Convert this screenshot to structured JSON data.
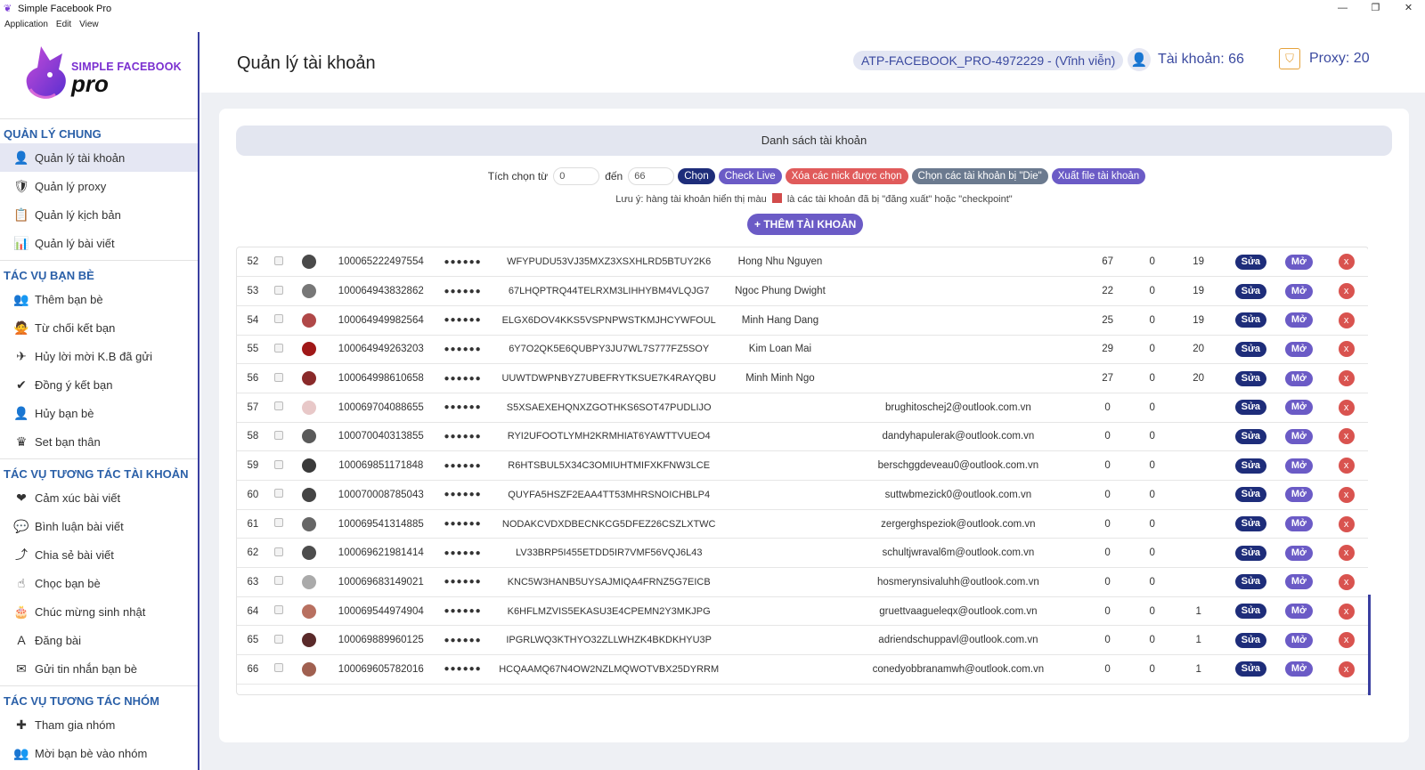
{
  "window": {
    "title": "Simple Facebook Pro",
    "controls": [
      "—",
      "❐",
      "✕"
    ]
  },
  "menu": [
    "Application",
    "Edit",
    "View"
  ],
  "logo": {
    "line1": "SIMPLE FACEBOOK",
    "line2": "pro"
  },
  "sidebar": {
    "sections": [
      {
        "title": "QUẢN LÝ CHUNG",
        "items": [
          {
            "label": "Quản lý tài khoản",
            "icon": "user-icon",
            "glyph": "👤",
            "active": true
          },
          {
            "label": "Quản lý proxy",
            "icon": "proxy-icon",
            "glyph": "🛡"
          },
          {
            "label": "Quản lý kịch bản",
            "icon": "script-icon",
            "glyph": "📋"
          },
          {
            "label": "Quản lý bài viết",
            "icon": "post-icon",
            "glyph": "📊"
          }
        ]
      },
      {
        "title": "TÁC VỤ BẠN BÈ",
        "items": [
          {
            "label": "Thêm bạn bè",
            "icon": "add-friend-icon",
            "glyph": "👥"
          },
          {
            "label": "Từ chối kết bạn",
            "icon": "decline-friend-icon",
            "glyph": "🙅"
          },
          {
            "label": "Hủy lời mời K.B đã gửi",
            "icon": "cancel-invite-icon",
            "glyph": "✈"
          },
          {
            "label": "Đồng ý kết bạn",
            "icon": "accept-friend-icon",
            "glyph": "✔"
          },
          {
            "label": "Hủy bạn bè",
            "icon": "unfriend-icon",
            "glyph": "👤"
          },
          {
            "label": "Set bạn thân",
            "icon": "best-friend-icon",
            "glyph": "♛"
          }
        ]
      },
      {
        "title": "TÁC VỤ TƯƠNG TÁC TÀI KHOẢN",
        "items": [
          {
            "label": "Cảm xúc bài viết",
            "icon": "reaction-icon",
            "glyph": "❤"
          },
          {
            "label": "Bình luận bài viết",
            "icon": "comment-icon",
            "glyph": "💬"
          },
          {
            "label": "Chia sẻ bài viết",
            "icon": "share-icon",
            "glyph": "⤴"
          },
          {
            "label": "Chọc bạn bè",
            "icon": "poke-icon",
            "glyph": "☝"
          },
          {
            "label": "Chúc mừng sinh nhật",
            "icon": "birthday-icon",
            "glyph": "🎂"
          },
          {
            "label": "Đăng bài",
            "icon": "post-a-icon",
            "glyph": "A"
          },
          {
            "label": "Gửi tin nhắn bạn bè",
            "icon": "messenger-icon",
            "glyph": "✉"
          }
        ]
      },
      {
        "title": "TÁC VỤ TƯƠNG TÁC NHÓM",
        "items": [
          {
            "label": "Tham gia nhóm",
            "icon": "join-group-icon",
            "glyph": "✚"
          },
          {
            "label": "Mời bạn bè vào nhóm",
            "icon": "invite-group-icon",
            "glyph": "👥"
          }
        ]
      }
    ]
  },
  "header": {
    "page_title": "Quản lý tài khoản",
    "license": "ATP-FACEBOOK_PRO-4972229 - (Vĩnh viễn)",
    "accounts": "Tài khoản: 66",
    "proxy": "Proxy: 20"
  },
  "list": {
    "title": "Danh sách tài khoản",
    "select_from_label": "Tích chọn từ",
    "from_value": "0",
    "to_label": "đến",
    "to_value": "66",
    "buttons": {
      "choose": "Chọn",
      "check_live": "Check Live",
      "delete_selected": "Xóa các nick được chọn",
      "select_die": "Chọn các tài khoản bị \"Die\"",
      "export": "Xuất file tài khoản"
    },
    "note_before": "Lưu ý: hàng tài khoản hiển thị màu",
    "note_after": "là các tài khoản đã bị \"đăng xuất\" hoặc \"checkpoint\"",
    "add_button": "+ THÊM TÀI KHOẢN",
    "row_buttons": {
      "edit": "Sửa",
      "open": "Mở",
      "delete": "x"
    },
    "password_mask": "●●●●●●"
  },
  "rows": [
    {
      "idx": "52",
      "uid": "100065222497554",
      "token": "WFYPUDU53VJ35MXZ3XSXHLRD5BTUY2K6",
      "name": "Hong Nhu Nguyen",
      "email": "",
      "n1": "67",
      "n2": "0",
      "n3": "19",
      "avatar": "#4a4a4a"
    },
    {
      "idx": "53",
      "uid": "100064943832862",
      "token": "67LHQPTRQ44TELRXM3LIHHYBM4VLQJG7",
      "name": "Ngoc Phung Dwight",
      "email": "",
      "n1": "22",
      "n2": "0",
      "n3": "19",
      "avatar": "#777"
    },
    {
      "idx": "54",
      "uid": "100064949982564",
      "token": "ELGX6DOV4KKS5VSPNPWSTKMJHCYWFOUL",
      "name": "Minh Hang Dang",
      "email": "",
      "n1": "25",
      "n2": "0",
      "n3": "19",
      "avatar": "#b04848"
    },
    {
      "idx": "55",
      "uid": "100064949263203",
      "token": "6Y7O2QK5E6QUBPY3JU7WL7S777FZ5SOY",
      "name": "Kim Loan Mai",
      "email": "",
      "n1": "29",
      "n2": "0",
      "n3": "20",
      "avatar": "#a01818"
    },
    {
      "idx": "56",
      "uid": "100064998610658",
      "token": "UUWTDWPNBYZ7UBEFRYTKSUE7K4RAYQBU",
      "name": "Minh Minh Ngo",
      "email": "",
      "n1": "27",
      "n2": "0",
      "n3": "20",
      "avatar": "#8a2a2a"
    },
    {
      "idx": "57",
      "uid": "100069704088655",
      "token": "S5XSAEXEHQNXZGOTHKS6SOT47PUDLIJO",
      "name": "",
      "email": "brughitoschej2@outlook.com.vn",
      "n1": "0",
      "n2": "0",
      "n3": "",
      "avatar": "#e8c8c8"
    },
    {
      "idx": "58",
      "uid": "100070040313855",
      "token": "RYI2UFOOTLYMH2KRMHIAT6YAWTTVUEO4",
      "name": "",
      "email": "dandyhapulerak@outlook.com.vn",
      "n1": "0",
      "n2": "0",
      "n3": "",
      "avatar": "#5a5a5a"
    },
    {
      "idx": "59",
      "uid": "100069851171848",
      "token": "R6HTSBUL5X34C3OMIUHTMIFXKFNW3LCE",
      "name": "",
      "email": "berschggdeveau0@outlook.com.vn",
      "n1": "0",
      "n2": "0",
      "n3": "",
      "avatar": "#3a3a3a"
    },
    {
      "idx": "60",
      "uid": "100070008785043",
      "token": "QUYFA5HSZF2EAA4TT53MHRSNOICHBLP4",
      "name": "",
      "email": "suttwbmezick0@outlook.com.vn",
      "n1": "0",
      "n2": "0",
      "n3": "",
      "avatar": "#444"
    },
    {
      "idx": "61",
      "uid": "100069541314885",
      "token": "NODAKCVDXDBECNKCG5DFEZ26CSZLXTWC",
      "name": "",
      "email": "zergerghspeziok@outlook.com.vn",
      "n1": "0",
      "n2": "0",
      "n3": "",
      "avatar": "#666"
    },
    {
      "idx": "62",
      "uid": "100069621981414",
      "token": "LV33BRP5I455ETDD5IR7VMF56VQJ6L43",
      "name": "",
      "email": "schultjwraval6m@outlook.com.vn",
      "n1": "0",
      "n2": "0",
      "n3": "",
      "avatar": "#4d4d4d"
    },
    {
      "idx": "63",
      "uid": "100069683149021",
      "token": "KNC5W3HANB5UYSAJMIQA4FRNZ5G7EICB",
      "name": "",
      "email": "hosmerynsivaluhh@outlook.com.vn",
      "n1": "0",
      "n2": "0",
      "n3": "",
      "avatar": "#aaa"
    },
    {
      "idx": "64",
      "uid": "100069544974904",
      "token": "K6HFLMZVIS5EKASU3E4CPEMN2Y3MKJPG",
      "name": "",
      "email": "gruettvaagueleqx@outlook.com.vn",
      "n1": "0",
      "n2": "0",
      "n3": "1",
      "avatar": "#b87060"
    },
    {
      "idx": "65",
      "uid": "100069889960125",
      "token": "IPGRLWQ3KTHYO32ZLLWHZK4BKDKHYU3P",
      "name": "",
      "email": "adriendschuppavl@outlook.com.vn",
      "n1": "0",
      "n2": "0",
      "n3": "1",
      "avatar": "#5a2a2a"
    },
    {
      "idx": "66",
      "uid": "100069605782016",
      "token": "HCQAAMQ67N4OW2NZLMQWOTVBX25DYRRM",
      "name": "",
      "email": "conedyobbranamwh@outlook.com.vn",
      "n1": "0",
      "n2": "0",
      "n3": "1",
      "avatar": "#a06050"
    }
  ]
}
